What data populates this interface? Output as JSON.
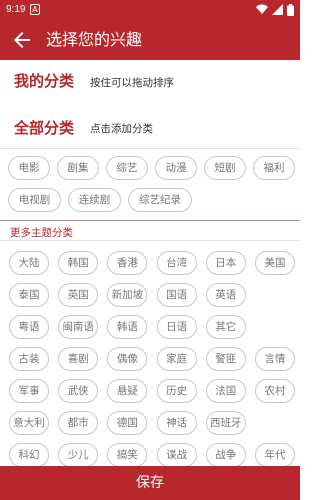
{
  "status_bar": {
    "time": "9:19",
    "notification_glyph": "A",
    "icons": [
      "wifi-icon",
      "signal-icon",
      "battery-icon"
    ]
  },
  "app_bar": {
    "title": "选择您的兴趣",
    "back_icon": "arrow-left-icon"
  },
  "my_categories": {
    "title": "我的分类",
    "hint": "按住可以拖动排序"
  },
  "all_categories": {
    "title": "全部分类",
    "hint": "点击添加分类",
    "items": [
      "电影",
      "剧集",
      "综艺",
      "动漫",
      "短剧",
      "福利",
      "电视剧",
      "连续剧",
      "综艺纪录"
    ]
  },
  "more_topics": {
    "title": "更多主题分类",
    "rows": [
      [
        "大陆",
        "韩国",
        "香港",
        "台湾",
        "日本",
        "美国"
      ],
      [
        "泰国",
        "英国",
        "新加坡",
        "国语",
        "英语"
      ],
      [
        "粤语",
        "闽南语",
        "韩语",
        "日语",
        "其它"
      ],
      [
        "古装",
        "喜剧",
        "偶像",
        "家庭",
        "警匪",
        "言情"
      ],
      [
        "军事",
        "武侠",
        "悬疑",
        "历史",
        "法国",
        "农村"
      ],
      [
        "意大利",
        "都市",
        "德国",
        "神话",
        "西班牙"
      ],
      [
        "科幻",
        "少儿",
        "搞笑",
        "谍战",
        "战争",
        "年代"
      ]
    ]
  },
  "save_button": {
    "label": "保存"
  },
  "colors": {
    "accent": "#b8272b",
    "chip_border": "#c8c8c8",
    "chip_text": "#777777"
  }
}
